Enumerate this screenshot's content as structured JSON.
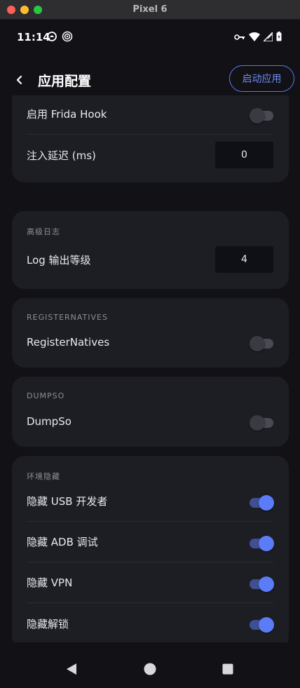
{
  "window": {
    "title": "Pixel 6"
  },
  "status_bar": {
    "time": "11:14"
  },
  "app_bar": {
    "title": "应用配置",
    "launch_button": "启动应用"
  },
  "frida_card": {
    "enable_frida_label": "启用 Frida Hook",
    "enable_frida_on": false,
    "inject_delay_label": "注入延迟 (ms)",
    "inject_delay_value": "0"
  },
  "advanced_log_card": {
    "section_title": "高级日志",
    "log_level_label": "Log 输出等级",
    "log_level_value": "4"
  },
  "register_natives_card": {
    "section_title": "REGISTERNATIVES",
    "label": "RegisterNatives",
    "on": false
  },
  "dumpso_card": {
    "section_title": "DUMPSO",
    "label": "DumpSo",
    "on": false
  },
  "env_hide_card": {
    "section_title": "环境隐藏",
    "items": [
      {
        "label": "隐藏 USB 开发者",
        "on": true
      },
      {
        "label": "隐藏 ADB 调试",
        "on": true
      },
      {
        "label": "隐藏 VPN",
        "on": true
      },
      {
        "label": "隐藏解锁",
        "on": true
      }
    ]
  },
  "colors": {
    "accent": "#5b7cf6",
    "background": "#111116",
    "card": "#1d1e24"
  }
}
